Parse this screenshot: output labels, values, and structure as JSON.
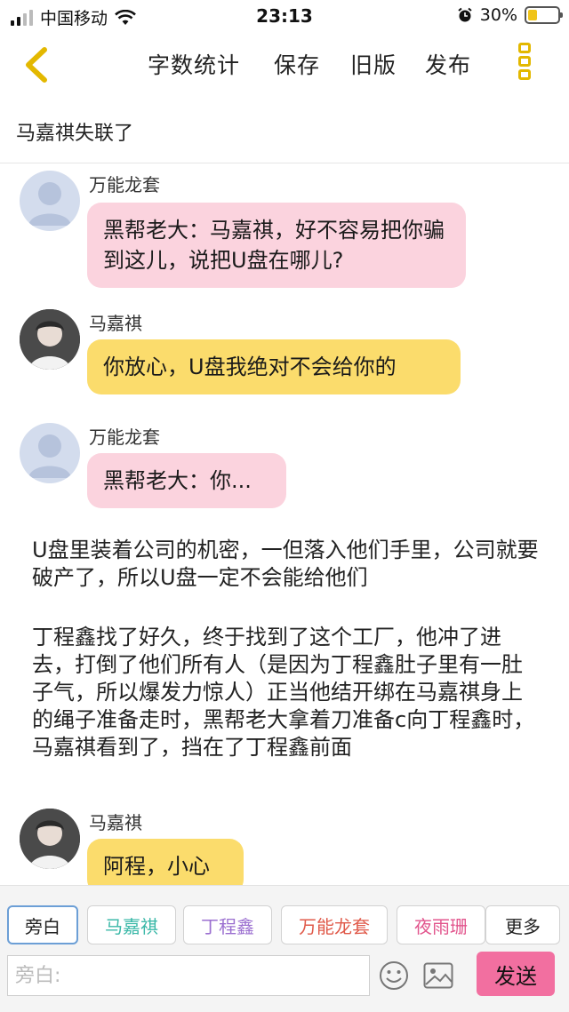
{
  "status_bar": {
    "carrier": "中国移动",
    "time": "23:13",
    "battery": "30%",
    "battery_level": 0.3
  },
  "toolbar": {
    "items": [
      "字数统计",
      "保存",
      "旧版",
      "发布"
    ],
    "back_icon": "chevron-left-icon",
    "more_icon": "vertical-menu-icon",
    "accent": "#e3b800"
  },
  "document": {
    "title": "马嘉祺失联了"
  },
  "chat": {
    "messages": [
      {
        "sender": "万能龙套",
        "text": "黑帮老大：马嘉祺，好不容易把你骗到这儿，说把U盘在哪儿?",
        "color": "#fbd3de"
      },
      {
        "sender": "马嘉祺",
        "text": "你放心，U盘我绝对不会给你的",
        "color": "#fbdc6c"
      },
      {
        "sender": "万能龙套",
        "text": "黑帮老大：你...",
        "color": "#fbd3de"
      },
      {
        "sender": "马嘉祺",
        "text": "阿程，小心",
        "color": "#fbdc6c"
      }
    ],
    "narrations": [
      "U盘里装着公司的机密，一但落入他们手里，公司就要破产了，所以U盘一定不会能给他们",
      "丁程鑫找了好久，终于找到了这个工厂，他冲了进去，打倒了他们所有人（是因为丁程鑫肚子里有一肚子气，所以爆发力惊人）正当他结开绑在马嘉祺身上的绳子准备走时，黑帮老大拿着刀准备c向丁程鑫时，马嘉祺看到了，挡在了丁程鑫前面"
    ]
  },
  "bottom_bar": {
    "roles": [
      {
        "label": "旁白",
        "color": "#222222"
      },
      {
        "label": "马嘉祺",
        "color": "#3bb8a8"
      },
      {
        "label": "丁程鑫",
        "color": "#9b6fd0"
      },
      {
        "label": "万能龙套",
        "color": "#e05a4a"
      },
      {
        "label": "夜雨珊",
        "color": "#e2558d"
      },
      {
        "label": "更多",
        "color": "#222222"
      }
    ],
    "input_placeholder": "旁白:",
    "send_label": "发送",
    "send_color": "#f26fa0"
  }
}
